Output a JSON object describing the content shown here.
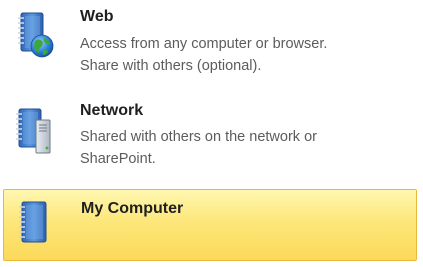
{
  "options": [
    {
      "icon": "web-notebook-icon",
      "title": "Web",
      "description_lines": [
        "Access from any computer or browser.",
        "Share with others (optional)."
      ]
    },
    {
      "icon": "network-notebook-icon",
      "title": "Network",
      "description_lines": [
        "Shared with others on the network or",
        "SharePoint."
      ]
    },
    {
      "icon": "computer-notebook-icon",
      "title": "My Computer",
      "description_lines": []
    }
  ],
  "selected_option": "My Computer",
  "colors": {
    "selection_fill": "#fde77a",
    "selection_border": "#e8b93a",
    "title_text": "#1f1f1f",
    "description_text": "#5c5c5c",
    "notebook_blue": "#3f7fd0"
  }
}
